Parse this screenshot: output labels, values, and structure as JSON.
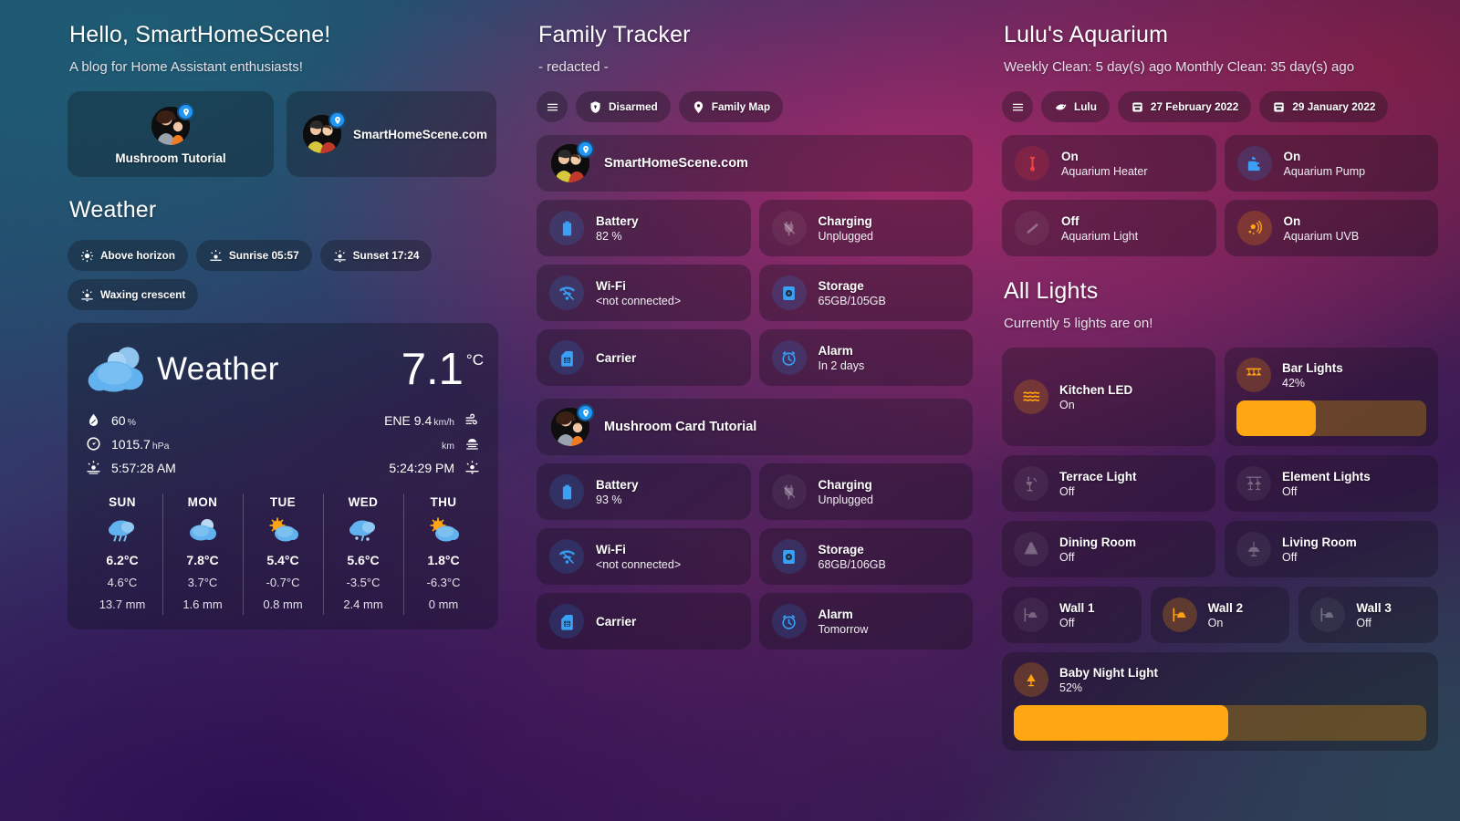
{
  "left": {
    "greeting": "Hello, SmartHomeScene!",
    "tagline": "A blog for Home Assistant enthusiasts!",
    "person_cards": [
      {
        "label": "Mushroom Tutorial",
        "icon": "person-avatar-mother"
      },
      {
        "label": "SmartHomeScene.com",
        "icon": "person-avatar-family"
      }
    ],
    "weather_title": "Weather",
    "chips": [
      {
        "icon": "sun-above-horizon-icon",
        "label": "Above horizon"
      },
      {
        "icon": "sunrise-icon",
        "label": "Sunrise 05:57"
      },
      {
        "icon": "sunset-icon",
        "label": "Sunset 17:24"
      },
      {
        "icon": "moon-phase-icon",
        "label": "Waxing crescent"
      }
    ],
    "weather": {
      "name": "Weather",
      "temperature": "7.1",
      "temperature_unit": "°C",
      "condition_icon": "cloudy-icon",
      "attrs_left": [
        {
          "icon": "humidity-icon",
          "value": "60",
          "unit": "%"
        },
        {
          "icon": "pressure-gauge-icon",
          "value": "1015.7",
          "unit": "hPa"
        },
        {
          "icon": "sunrise-icon",
          "value": "5:57:28 AM",
          "unit": ""
        }
      ],
      "attrs_right": [
        {
          "icon": "wind-icon",
          "value": "ENE 9.4",
          "unit": "km/h"
        },
        {
          "icon": "visibility-fog-icon",
          "value": "",
          "unit": "km"
        },
        {
          "icon": "sunset-icon",
          "value": "5:24:29 PM",
          "unit": ""
        }
      ],
      "forecast": [
        {
          "day": "SUN",
          "icon": "rainy-icon",
          "high": "6.2°C",
          "low": "4.6°C",
          "precip": "13.7 mm"
        },
        {
          "day": "MON",
          "icon": "cloudy-icon",
          "high": "7.8°C",
          "low": "3.7°C",
          "precip": "1.6 mm"
        },
        {
          "day": "TUE",
          "icon": "partly-cloudy-icon",
          "high": "5.4°C",
          "low": "-0.7°C",
          "precip": "0.8 mm"
        },
        {
          "day": "WED",
          "icon": "snowy-rainy-icon",
          "high": "5.6°C",
          "low": "-3.5°C",
          "precip": "2.4 mm"
        },
        {
          "day": "THU",
          "icon": "partly-cloudy-icon",
          "high": "1.8°C",
          "low": "-6.3°C",
          "precip": "0 mm"
        }
      ]
    }
  },
  "middle": {
    "title": "Family Tracker",
    "subtitle": "- redacted -",
    "chips": [
      {
        "icon": "hamburger-menu-icon",
        "label": ""
      },
      {
        "icon": "shield-icon",
        "label": "Disarmed"
      },
      {
        "icon": "map-marker-icon",
        "label": "Family Map"
      }
    ],
    "people": [
      {
        "name": "SmartHomeScene.com",
        "avatar": "person-avatar-family",
        "tiles": [
          [
            {
              "icon": "battery-icon",
              "color": "blue",
              "t1": "Battery",
              "t2": "82 %"
            },
            {
              "icon": "power-plug-off-icon",
              "color": "grey",
              "t1": "Charging",
              "t2": "Unplugged"
            }
          ],
          [
            {
              "icon": "wifi-off-icon",
              "color": "blue",
              "t1": "Wi-Fi",
              "t2": "<not connected>"
            },
            {
              "icon": "storage-icon",
              "color": "blue",
              "t1": "Storage",
              "t2": "65GB/105GB"
            }
          ],
          [
            {
              "icon": "sim-card-icon",
              "color": "blue",
              "t1": "Carrier",
              "t2": ""
            },
            {
              "icon": "alarm-clock-icon",
              "color": "blue",
              "t1": "Alarm",
              "t2": "In 2 days"
            }
          ]
        ]
      },
      {
        "name": "Mushroom Card Tutorial",
        "avatar": "person-avatar-mother",
        "tiles": [
          [
            {
              "icon": "battery-icon",
              "color": "blue",
              "t1": "Battery",
              "t2": "93 %"
            },
            {
              "icon": "power-plug-off-icon",
              "color": "grey",
              "t1": "Charging",
              "t2": "Unplugged"
            }
          ],
          [
            {
              "icon": "wifi-off-icon",
              "color": "blue",
              "t1": "Wi-Fi",
              "t2": "<not connected>"
            },
            {
              "icon": "storage-icon",
              "color": "blue",
              "t1": "Storage",
              "t2": "68GB/106GB"
            }
          ],
          [
            {
              "icon": "sim-card-icon",
              "color": "blue",
              "t1": "Carrier",
              "t2": ""
            },
            {
              "icon": "alarm-clock-icon",
              "color": "blue",
              "t1": "Alarm",
              "t2": "Tomorrow"
            }
          ]
        ]
      }
    ]
  },
  "right": {
    "aquarium": {
      "title": "Lulu's Aquarium",
      "subtitle": "Weekly Clean: 5 day(s) ago Monthly Clean: 35 day(s) ago",
      "chips": [
        {
          "icon": "hamburger-menu-icon",
          "label": ""
        },
        {
          "icon": "fish-icon",
          "label": "Lulu"
        },
        {
          "icon": "calendar-clean-icon",
          "label": "27 February 2022"
        },
        {
          "icon": "calendar-clean-icon",
          "label": "29 January 2022"
        }
      ],
      "tiles": [
        [
          {
            "icon": "thermometer-heater-icon",
            "color": "red",
            "t1": "On",
            "t2": "Aquarium Heater"
          },
          {
            "icon": "water-pump-icon",
            "color": "blue",
            "t1": "On",
            "t2": "Aquarium Pump"
          }
        ],
        [
          {
            "icon": "light-tube-icon",
            "color": "grey",
            "t1": "Off",
            "t2": "Aquarium Light"
          },
          {
            "icon": "uvb-sun-icon",
            "color": "amber",
            "t1": "On",
            "t2": "Aquarium UVB"
          }
        ]
      ]
    },
    "lights": {
      "title": "All Lights",
      "subtitle": "Currently 5 lights are on!",
      "row1": [
        {
          "icon": "led-strip-icon",
          "color": "amber",
          "name": "Kitchen LED",
          "state": "On",
          "slider": null
        },
        {
          "icon": "bar-lights-icon",
          "color": "amber",
          "name": "Bar Lights",
          "state": "42%",
          "slider": 42
        }
      ],
      "row2": [
        {
          "icon": "outdoor-lamp-icon",
          "color": "grey",
          "name": "Terrace Light",
          "state": "Off"
        },
        {
          "icon": "ceiling-lights-icon",
          "color": "grey",
          "name": "Element Lights",
          "state": "Off"
        }
      ],
      "row3": [
        {
          "icon": "dining-lamp-icon",
          "color": "grey",
          "name": "Dining Room",
          "state": "Off"
        },
        {
          "icon": "pendant-light-icon",
          "color": "grey",
          "name": "Living Room",
          "state": "Off"
        }
      ],
      "row4": [
        {
          "icon": "wall-sconce-icon",
          "color": "grey",
          "name": "Wall 1",
          "state": "Off"
        },
        {
          "icon": "wall-sconce-icon",
          "color": "amber",
          "name": "Wall 2",
          "state": "On"
        },
        {
          "icon": "wall-sconce-icon",
          "color": "grey",
          "name": "Wall 3",
          "state": "Off"
        }
      ],
      "bignight": {
        "icon": "night-light-icon",
        "color": "amber",
        "name": "Baby Night Light",
        "state": "52%",
        "slider": 52
      }
    }
  },
  "colors": {
    "accent_blue": "#3aa0f5",
    "accent_amber": "#ffa713",
    "accent_red": "#f0413b",
    "slider_track": "#96681a"
  }
}
